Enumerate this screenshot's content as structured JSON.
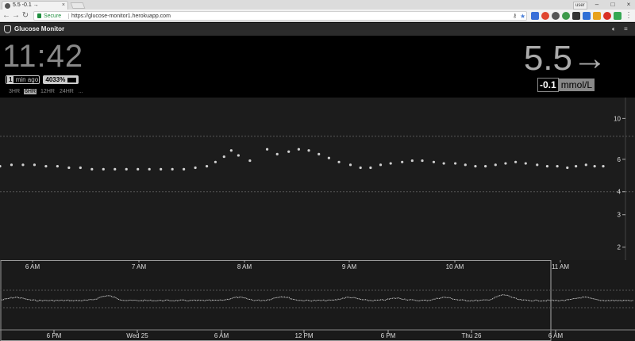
{
  "browser": {
    "tab_title": "5.5 -0.1 →",
    "url": "https://glucose-monitor1.herokuapp.com",
    "security_label": "Secure",
    "user_pill": "user"
  },
  "app": {
    "title": "Glucose Monitor"
  },
  "status": {
    "time": "11:42",
    "minutes_ago": "1",
    "ago_label": "min ago",
    "battery": "4033%",
    "bg": "5.5",
    "arrow": "→",
    "delta": "-0.1",
    "units": "mmol/L",
    "ranges": [
      "3HR",
      "6HR",
      "12HR",
      "24HR",
      "..."
    ],
    "active_range": "6HR"
  },
  "colors": {
    "background": "#000000",
    "chart_bg": "#1c1c1c",
    "points": "#d0d0d0",
    "threshold_lines": "#555555"
  },
  "chart_data": [
    {
      "type": "scatter",
      "name": "focus",
      "x_ticks": [
        "6 AM",
        "7 AM",
        "8 AM",
        "9 AM",
        "10 AM",
        "11 AM"
      ],
      "y_ticks": [
        2,
        3,
        4,
        6,
        10
      ],
      "y_scale": "log",
      "ylim": [
        1.7,
        12
      ],
      "threshold_lines": [
        4,
        8
      ],
      "x_range_minutes": [
        320,
        740
      ],
      "points": [
        [
          320,
          5.5
        ],
        [
          328,
          5.6
        ],
        [
          336,
          5.6
        ],
        [
          344,
          5.6
        ],
        [
          352,
          5.5
        ],
        [
          360,
          5.5
        ],
        [
          368,
          5.4
        ],
        [
          376,
          5.4
        ],
        [
          384,
          5.3
        ],
        [
          392,
          5.3
        ],
        [
          400,
          5.3
        ],
        [
          408,
          5.3
        ],
        [
          416,
          5.3
        ],
        [
          424,
          5.3
        ],
        [
          432,
          5.3
        ],
        [
          440,
          5.3
        ],
        [
          448,
          5.3
        ],
        [
          456,
          5.4
        ],
        [
          464,
          5.5
        ],
        [
          470,
          5.8
        ],
        [
          476,
          6.2
        ],
        [
          481,
          6.7
        ],
        [
          486,
          6.3
        ],
        [
          494,
          5.9
        ],
        [
          506,
          6.8
        ],
        [
          513,
          6.4
        ],
        [
          521,
          6.6
        ],
        [
          528,
          6.8
        ],
        [
          535,
          6.7
        ],
        [
          542,
          6.4
        ],
        [
          549,
          6.1
        ],
        [
          556,
          5.8
        ],
        [
          564,
          5.6
        ],
        [
          571,
          5.4
        ],
        [
          578,
          5.4
        ],
        [
          585,
          5.6
        ],
        [
          592,
          5.7
        ],
        [
          600,
          5.8
        ],
        [
          607,
          5.9
        ],
        [
          614,
          5.9
        ],
        [
          622,
          5.8
        ],
        [
          629,
          5.7
        ],
        [
          637,
          5.7
        ],
        [
          644,
          5.6
        ],
        [
          651,
          5.5
        ],
        [
          658,
          5.5
        ],
        [
          665,
          5.6
        ],
        [
          672,
          5.7
        ],
        [
          679,
          5.8
        ],
        [
          686,
          5.7
        ],
        [
          694,
          5.6
        ],
        [
          701,
          5.5
        ],
        [
          708,
          5.5
        ],
        [
          715,
          5.4
        ],
        [
          721,
          5.5
        ],
        [
          728,
          5.6
        ],
        [
          734,
          5.5
        ],
        [
          740,
          5.5
        ]
      ]
    },
    {
      "type": "line",
      "name": "context",
      "x_ticks": [
        "6 PM",
        "Wed 25",
        "6 AM",
        "12 PM",
        "6 PM",
        "Thu 26",
        "6 AM"
      ],
      "threshold_lines": [
        4,
        8
      ]
    }
  ]
}
